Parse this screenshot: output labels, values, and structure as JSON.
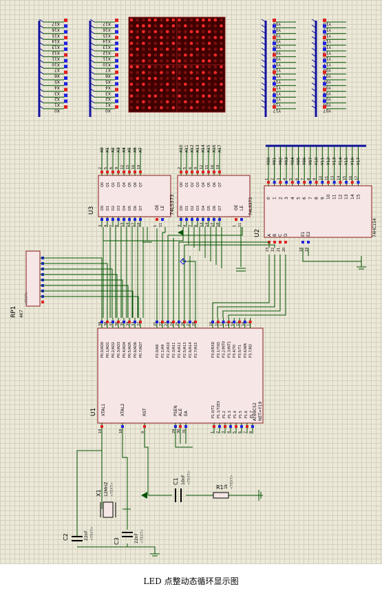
{
  "caption": "LED 点整动态循环显示图",
  "colors": {
    "wire": "#005400",
    "body": "#f6e6e6",
    "outline": "#8b1a1a",
    "pin_red": "#e02020",
    "pin_blue": "#2020e0",
    "bus": "#1010a0",
    "matrix_bg": "#400000",
    "led_on": "#ff2a2a",
    "led_dim": "#7a1010"
  },
  "u1": {
    "ref": "U1",
    "part": "AT89C52",
    "net": "NET=Y19",
    "top_pin_numbers": [
      "39",
      "38",
      "37",
      "36",
      "35",
      "34",
      "33",
      "32",
      "21",
      "22",
      "23",
      "24",
      "25",
      "26",
      "27",
      "28",
      "10",
      "11",
      "12",
      "13",
      "14",
      "15",
      "16",
      "17"
    ],
    "port0": [
      "P0.0/AD0",
      "P0.1/AD1",
      "P0.2/AD2",
      "P0.3/AD3",
      "P0.4/AD4",
      "P0.5/AD5",
      "P0.6/AD6",
      "P0.7/AD7"
    ],
    "port2": [
      "P2.0/A8",
      "P2.1/A9",
      "P2.2/A10",
      "P2.3/A11",
      "P2.4/A12",
      "P2.5/A13",
      "P2.6/A14",
      "P2.7/A15"
    ],
    "port3": [
      "P3.0/RXD",
      "P3.1/TXD",
      "P3.2/INT0",
      "P3.3/INT1",
      "P3.4/T0",
      "P3.5/T1",
      "P3.6/WR",
      "P3.7/RD"
    ],
    "xtal1": "XTAL1",
    "xtal2": "XTAL2",
    "rst": "RST",
    "psen": "PSEN",
    "ale": "ALE",
    "ea": "EA",
    "port1": [
      "P1.0/T2",
      "P1.1/T2EX",
      "P1.2",
      "P1.3",
      "P1.4",
      "P1.5",
      "P1.6",
      "P1.7"
    ],
    "bottom_pin_numbers": [
      "19",
      "18",
      "9",
      "29",
      "30",
      "31",
      "1",
      "2",
      "3",
      "4",
      "5",
      "6",
      "7",
      "8"
    ]
  },
  "u3": {
    "ref": "U3",
    "part": "74LS373",
    "q": [
      "Q0",
      "Q1",
      "Q2",
      "Q3",
      "Q4",
      "Q5",
      "Q6",
      "Q7"
    ],
    "d": [
      "D0",
      "D1",
      "D2",
      "D3",
      "D4",
      "D5",
      "D6",
      "D7"
    ],
    "oe": "OE",
    "le": "LE",
    "top_pins": [
      "2",
      "5",
      "6",
      "9",
      "12",
      "15",
      "16",
      "19"
    ],
    "bottom_pins": [
      "3",
      "4",
      "7",
      "8",
      "13",
      "14",
      "17",
      "18",
      "1",
      "11"
    ],
    "nets": [
      "X0",
      "X1",
      "X2",
      "X3",
      "X4",
      "X5",
      "X6",
      "X7"
    ]
  },
  "u4": {
    "part": "74LS373",
    "q": [
      "Q0",
      "Q1",
      "Q2",
      "Q3",
      "Q4",
      "Q5",
      "Q6",
      "Q7"
    ],
    "d": [
      "D0",
      "D1",
      "D2",
      "D3",
      "D4",
      "D5",
      "D6",
      "D7"
    ],
    "oe": "OE",
    "le": "LE",
    "top_pins": [
      "2",
      "5",
      "6",
      "9",
      "12",
      "15",
      "16",
      "19"
    ],
    "bottom_pins": [
      "3",
      "4",
      "7",
      "8",
      "13",
      "14",
      "17",
      "18",
      "1",
      "11"
    ],
    "nets": [
      "X10",
      "X11",
      "X12",
      "X13",
      "X14",
      "X15",
      "X16",
      "X17"
    ]
  },
  "u2": {
    "ref": "U2",
    "part": "74HC154",
    "top_pins": [
      "1",
      "2",
      "3",
      "4",
      "5",
      "6",
      "7",
      "8",
      "9",
      "10",
      "11",
      "13",
      "14",
      "15",
      "16",
      "17"
    ],
    "outputs": [
      "0",
      "1",
      "2",
      "3",
      "4",
      "5",
      "6",
      "7",
      "8",
      "9",
      "10",
      "11",
      "12",
      "13",
      "14",
      "15"
    ],
    "nets": [
      "Y00",
      "Y01",
      "Y02",
      "Y03",
      "Y04",
      "Y05",
      "Y06",
      "Y07",
      "Y10",
      "Y11",
      "Y12",
      "Y13",
      "Y14",
      "Y15",
      "Y16",
      "Y17"
    ],
    "inputs": [
      "A",
      "B",
      "C",
      "D"
    ],
    "enables": [
      "E1",
      "E2"
    ],
    "bottom_pins": [
      "23",
      "22",
      "21",
      "20",
      "18",
      "19"
    ]
  },
  "rp1": {
    "ref": "RP1",
    "value": "4K7",
    "text": "<TEXT>"
  },
  "matrix_left_labels_a": [
    "X17",
    "X16",
    "X15",
    "X14",
    "X13",
    "X12",
    "X11",
    "X10",
    "X7",
    "X6",
    "X5",
    "X4",
    "X3",
    "X2",
    "X1",
    "X0"
  ],
  "matrix_left_labels_b": [
    "X17",
    "X16",
    "X15",
    "X14",
    "X13",
    "X12",
    "X11",
    "X10",
    "X7",
    "X6",
    "X5",
    "X4",
    "X3",
    "X2",
    "X1",
    "X0"
  ],
  "matrix_right_labels_a": [
    "Y00",
    "Y01",
    "Y02",
    "Y03",
    "Y04",
    "Y05",
    "Y06",
    "Y07",
    "Y10",
    "Y11",
    "Y12",
    "Y13",
    "Y14",
    "Y15",
    "Y16",
    "Y17"
  ],
  "matrix_right_labels_b": [
    "Y10",
    "Y11",
    "Y12",
    "Y13",
    "Y14",
    "Y15",
    "Y16",
    "Y17",
    "Y00",
    "Y01",
    "Y02",
    "Y03",
    "Y04",
    "Y05",
    "Y06",
    "Y07"
  ],
  "x1": {
    "ref": "X1",
    "value": "12MHZ",
    "text": "<TEXT>"
  },
  "c1": {
    "ref": "C1",
    "value": "10nF",
    "text": "<TEXT>"
  },
  "c2": {
    "ref": "C2",
    "value": "22nF",
    "text": "<TEXT>"
  },
  "c3": {
    "ref": "C3",
    "value": "22nF",
    "text": "<TEXT>"
  },
  "r1": {
    "ref": "R1",
    "value": "1k",
    "text": "<TEXT>"
  }
}
